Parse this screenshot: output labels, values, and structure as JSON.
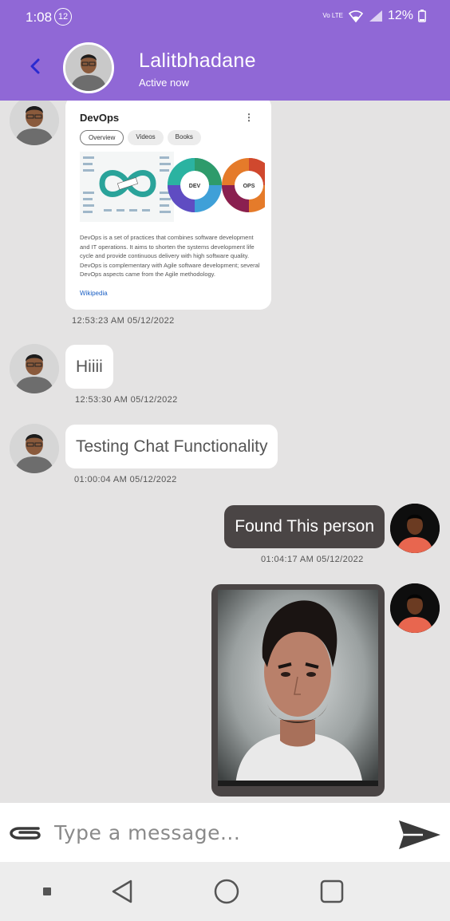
{
  "status_bar": {
    "time": "1:08",
    "notification_count": "12",
    "volte": "Vo LTE",
    "battery": "12%"
  },
  "header": {
    "contact_name": "Lalitbhadane",
    "presence": "Active now"
  },
  "messages": [
    {
      "type": "card",
      "timestamp": "12:53:23 AM  05/12/2022",
      "card": {
        "title": "DevOps",
        "menu": "⋮",
        "tabs": [
          "Overview",
          "Videos",
          "Books"
        ],
        "diagram_labels": [
          "DEV",
          "OPS"
        ],
        "description": "DevOps is a set of practices that combines software development and IT operations. It aims to shorten the systems development life cycle and provide continuous delivery with high software quality. DevOps is complementary with Agile software development; several DevOps aspects came from the Agile methodology.",
        "source": "Wikipedia"
      }
    },
    {
      "type": "text",
      "direction": "incoming",
      "text": "Hiiii",
      "timestamp": "12:53:30 AM  05/12/2022"
    },
    {
      "type": "text",
      "direction": "incoming",
      "text": "Testing Chat Functionality",
      "timestamp": "01:00:04 AM  05/12/2022"
    },
    {
      "type": "text",
      "direction": "outgoing",
      "text": "Found This person",
      "timestamp": "01:04:17 AM  05/12/2022"
    },
    {
      "type": "image",
      "direction": "outgoing"
    }
  ],
  "composer": {
    "placeholder": "Type a message..."
  },
  "icons": {
    "back": "chevron-left-icon",
    "attach": "paperclip-icon",
    "send": "send-icon",
    "nav": [
      "stop-icon",
      "back-triangle-icon",
      "home-circle-icon",
      "recents-square-icon"
    ]
  },
  "colors": {
    "header": "#9068d6",
    "back_arrow": "#2a2ad0",
    "chat_background": "#e4e3e3",
    "incoming_bubble": "#ffffff",
    "outgoing_bubble": "#4a4545",
    "link": "#1a5fc4"
  }
}
